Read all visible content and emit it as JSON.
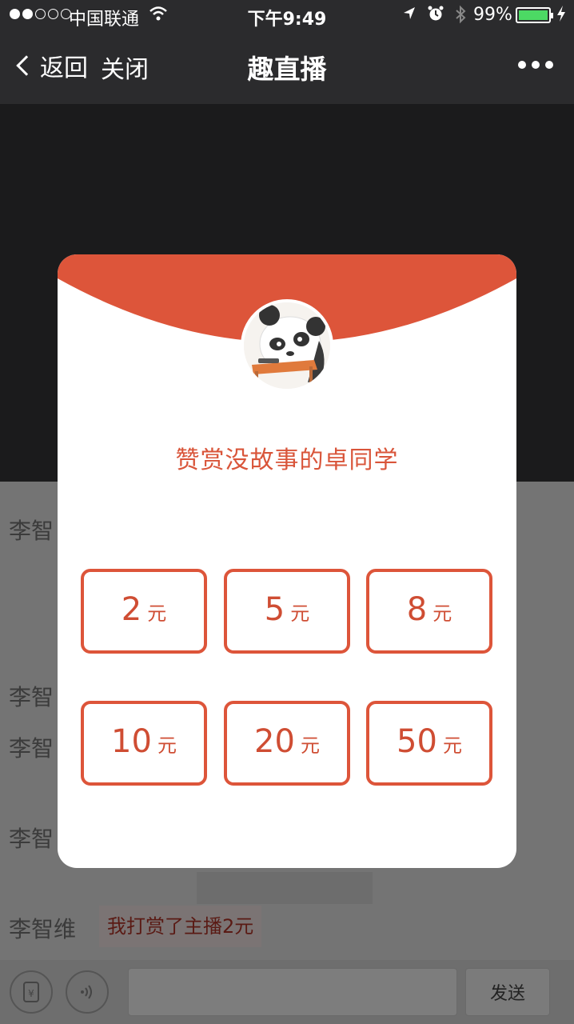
{
  "status_bar": {
    "carrier": "中国联通",
    "time": "下午9:49",
    "battery": "99%",
    "battery_level": 0.99,
    "signal_bars": 2,
    "icons": [
      "wifi-icon",
      "location-icon",
      "alarm-icon",
      "bluetooth-icon",
      "charging-icon"
    ]
  },
  "nav": {
    "back_label": "返回",
    "close_label": "关闭",
    "title": "趣直播",
    "more_icon": "more-dots-icon"
  },
  "chat": {
    "lines": [
      {
        "name": "李智"
      },
      {
        "name": "李智"
      },
      {
        "name": "李智"
      },
      {
        "name": "李智"
      },
      {
        "name": "李智维"
      }
    ],
    "last_message": "我打赏了主播2元",
    "send_label": "发送",
    "icons": [
      "red-packet-icon",
      "voice-icon"
    ]
  },
  "reward_modal": {
    "title": "赞赏没故事的卓同学",
    "avatar": "panda-avatar",
    "amounts": [
      {
        "value": "2",
        "unit": "元"
      },
      {
        "value": "5",
        "unit": "元"
      },
      {
        "value": "8",
        "unit": "元"
      },
      {
        "value": "10",
        "unit": "元"
      },
      {
        "value": "20",
        "unit": "元"
      },
      {
        "value": "50",
        "unit": "元"
      }
    ]
  },
  "colors": {
    "accent": "#dd553a",
    "nav_bg": "#2b2b2d",
    "video_bg": "#1b1b1c",
    "overlay_bg": "#747474",
    "battery_green": "#4cd964"
  }
}
